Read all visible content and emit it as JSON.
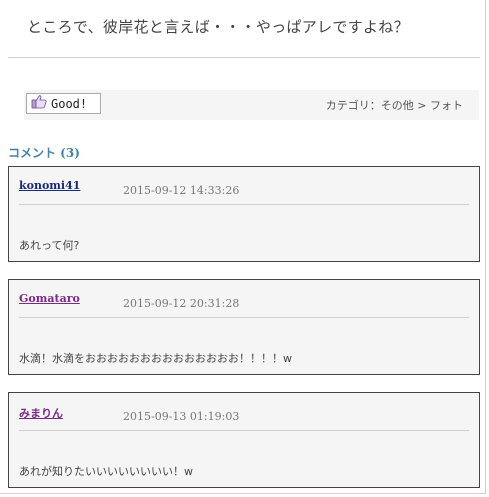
{
  "post": {
    "title": "ところで、彼岸花と言えば・・・やっぱアレですよね？"
  },
  "meta": {
    "good_label": "Good!",
    "good_icon": "thumbs-up-icon",
    "category": "カテゴリ：その他 > フォト"
  },
  "comments": {
    "header": "コメント (3)",
    "items": [
      {
        "name": "konomi41",
        "name_color": "#1a2a7a",
        "date": "2015-09-12 14:33:26",
        "body": "あれって何?"
      },
      {
        "name": "Gomataro",
        "name_color": "#7a2b86",
        "date": "2015-09-12 20:31:28",
        "body": "水滴！水滴をおおおおおおおおおおおおおお！！！！w"
      },
      {
        "name": "みまりん",
        "name_color": "#7a2b86",
        "date": "2015-09-13 01:19:03",
        "body": "あれが知りたいいいいいいいい！w"
      }
    ]
  }
}
